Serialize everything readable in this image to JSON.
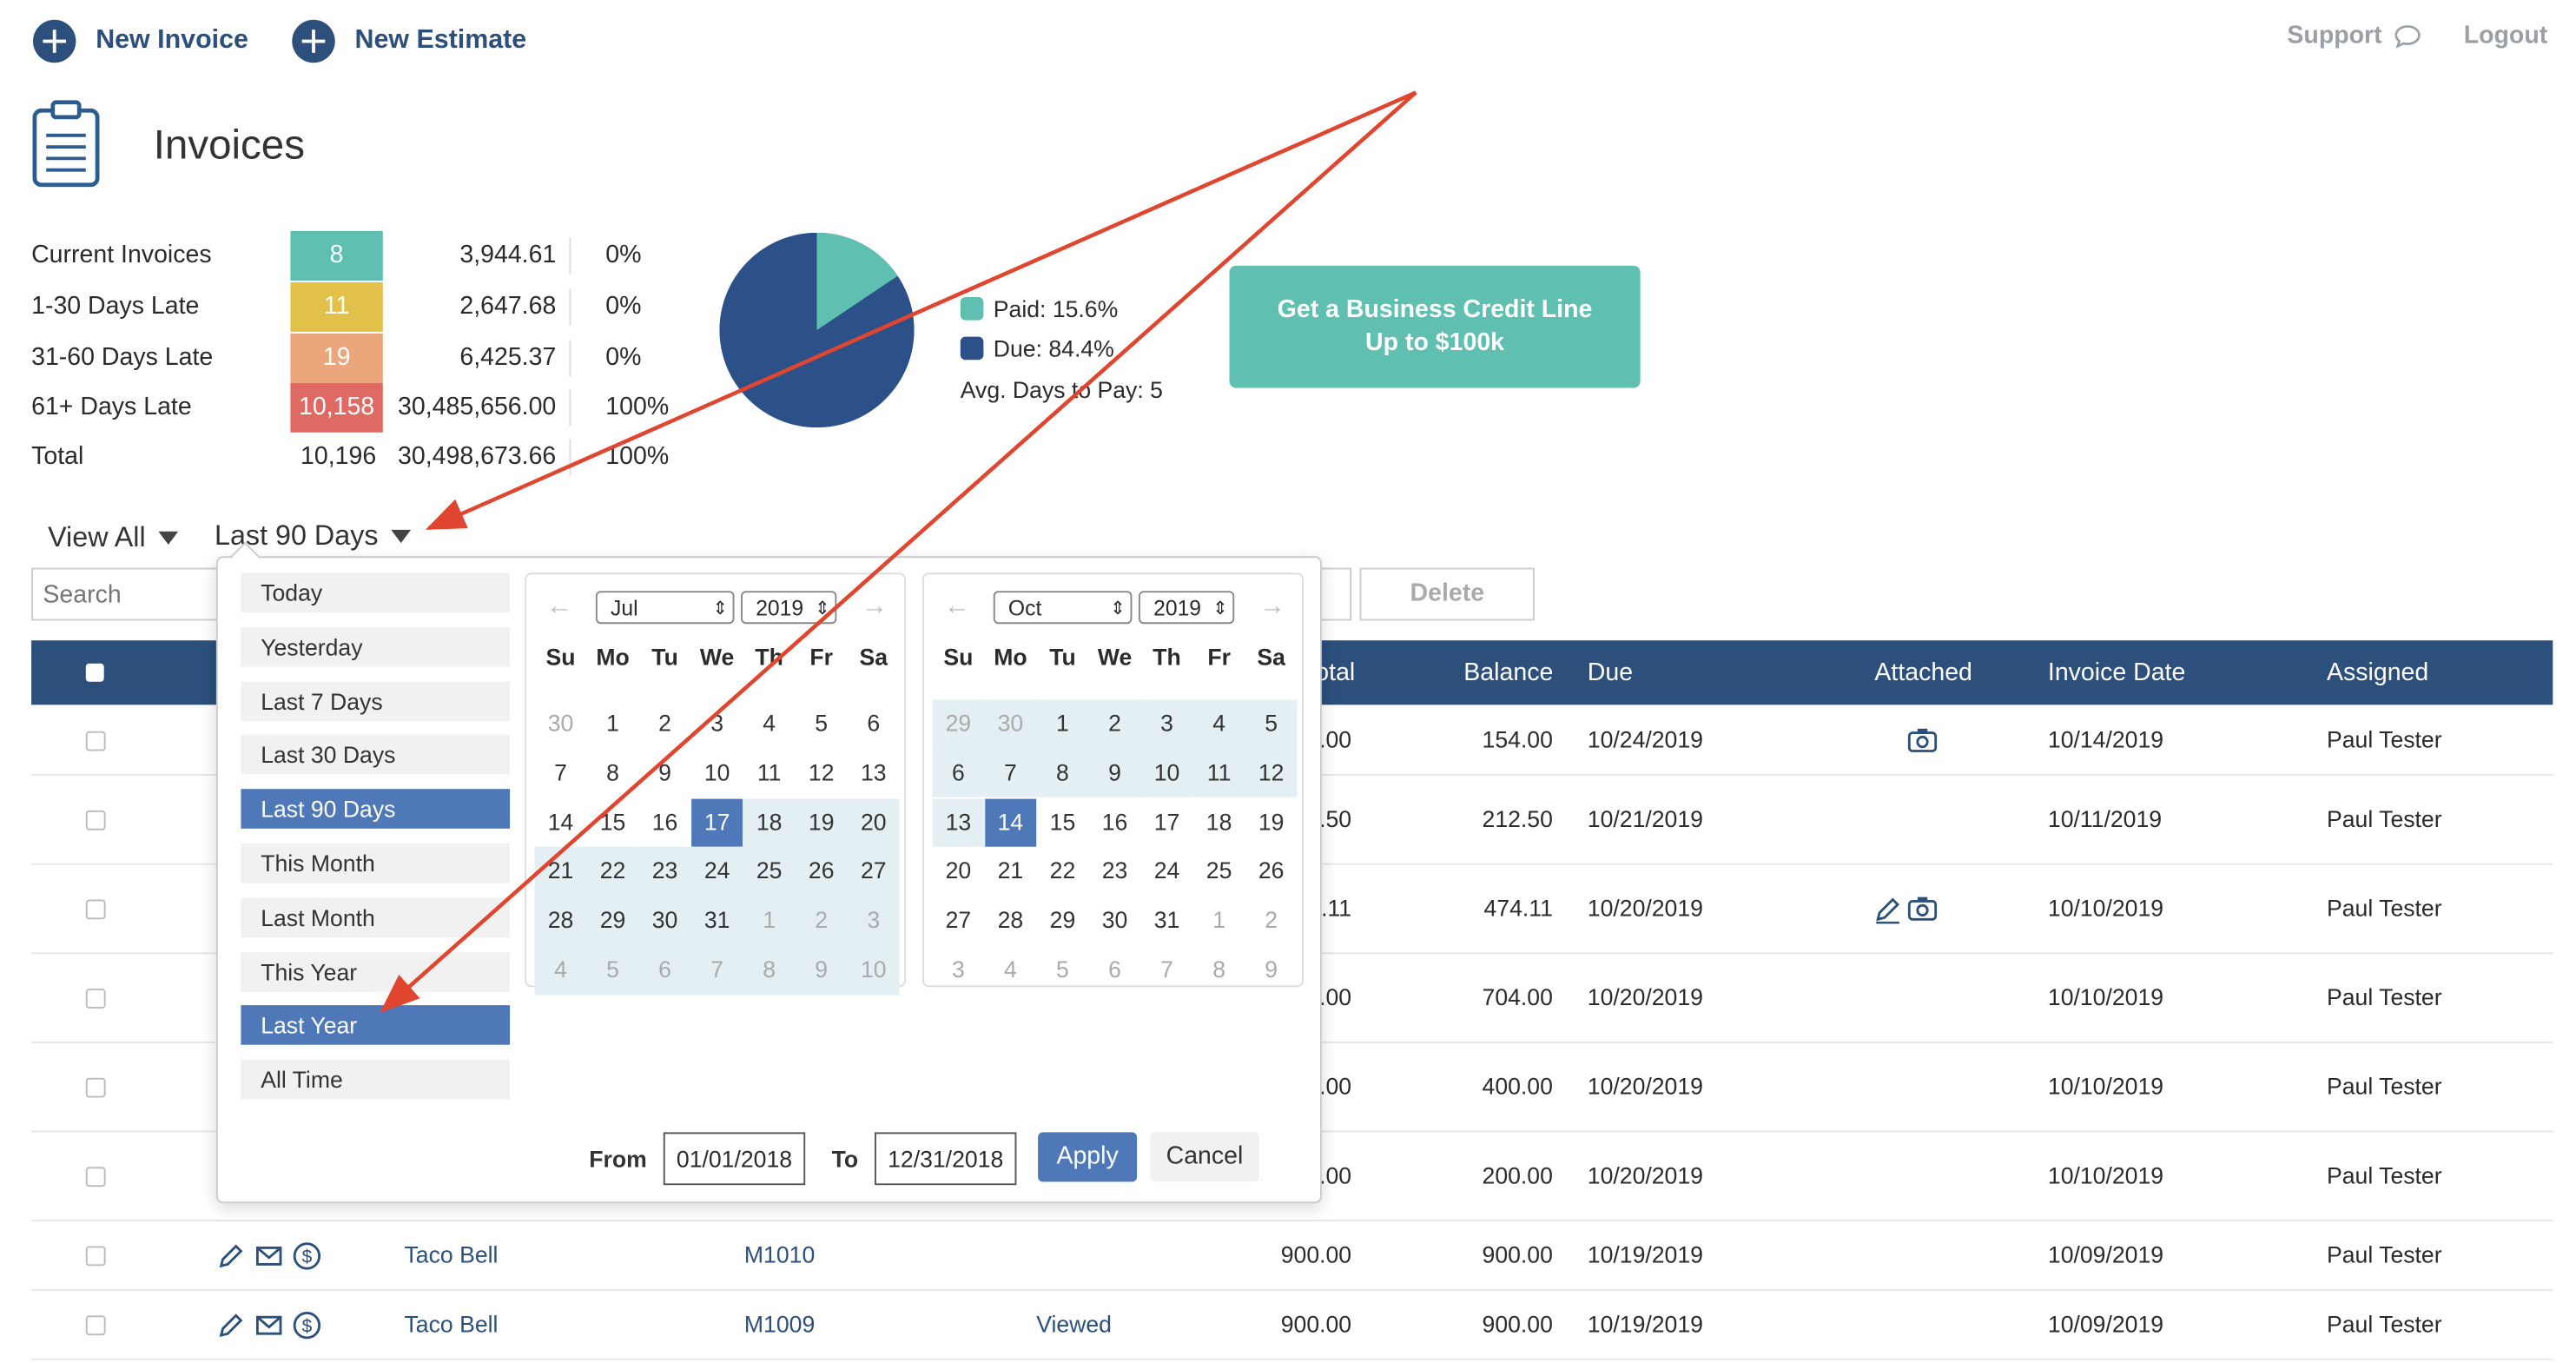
{
  "header": {
    "new_invoice": "New Invoice",
    "new_estimate": "New Estimate",
    "support": "Support",
    "logout": "Logout"
  },
  "page_title": "Invoices",
  "summary": [
    {
      "label": "Current Invoices",
      "count": "8",
      "amount": "3,944.61",
      "pct": "0%",
      "color": "#5fbfb0"
    },
    {
      "label": "1-30 Days Late",
      "count": "11",
      "amount": "2,647.68",
      "pct": "0%",
      "color": "#e2c14a"
    },
    {
      "label": "31-60 Days Late",
      "count": "19",
      "amount": "6,425.37",
      "pct": "0%",
      "color": "#eba67c"
    },
    {
      "label": "61+ Days Late",
      "count": "10,158",
      "amount": "30,485,656.00",
      "pct": "100%",
      "color": "#de6a63"
    },
    {
      "label": "Total",
      "count": "10,196",
      "amount": "30,498,673.66",
      "pct": "100%",
      "color": ""
    }
  ],
  "pie": {
    "paid_label": "Paid: 15.6%",
    "due_label": "Due: 84.4%",
    "avg_days": "Avg. Days to Pay: 5",
    "paid_fraction": 0.156,
    "paid_color": "#5fbfb0",
    "due_color": "#2c5188"
  },
  "promo": {
    "line1": "Get a Business Credit Line",
    "line2": "Up to $100k"
  },
  "filters": {
    "view_all": "View All",
    "period": "Last 90 Days"
  },
  "search": {
    "placeholder": "Search"
  },
  "delete_label": "Delete",
  "table": {
    "columns": {
      "total": "otal",
      "balance": "Balance",
      "due": "Due",
      "attached": "Attached",
      "invoice_date": "Invoice Date",
      "assigned": "Assigned"
    },
    "rows": [
      {
        "customer": "",
        "number": "",
        "status": "",
        "total": ".00",
        "balance": "154.00",
        "due": "10/24/2019",
        "date": "10/14/2019",
        "assigned": "Paul Tester"
      },
      {
        "customer": "",
        "number": "",
        "status": "",
        "total": ".50",
        "balance": "212.50",
        "due": "10/21/2019",
        "date": "10/11/2019",
        "assigned": "Paul Tester"
      },
      {
        "customer": "",
        "number": "",
        "status": "",
        "total": ".11",
        "balance": "474.11",
        "due": "10/20/2019",
        "date": "10/10/2019",
        "assigned": "Paul Tester"
      },
      {
        "customer": "",
        "number": "",
        "status": "",
        "total": ".00",
        "balance": "704.00",
        "due": "10/20/2019",
        "date": "10/10/2019",
        "assigned": "Paul Tester"
      },
      {
        "customer": "",
        "number": "",
        "status": "",
        "total": ".00",
        "balance": "400.00",
        "due": "10/20/2019",
        "date": "10/10/2019",
        "assigned": "Paul Tester"
      },
      {
        "customer": "",
        "number": "",
        "status": "",
        "total": ".00",
        "balance": "200.00",
        "due": "10/20/2019",
        "date": "10/10/2019",
        "assigned": "Paul Tester"
      },
      {
        "customer": "Taco Bell",
        "number": "M1010",
        "status": "",
        "total": "900.00",
        "balance": "900.00",
        "due": "10/19/2019",
        "date": "10/09/2019",
        "assigned": "Paul Tester"
      },
      {
        "customer": "Taco Bell",
        "number": "M1009",
        "status": "Viewed",
        "total": "900.00",
        "balance": "900.00",
        "due": "10/19/2019",
        "date": "10/09/2019",
        "assigned": "Paul Tester"
      }
    ]
  },
  "date_picker": {
    "ranges": [
      "Today",
      "Yesterday",
      "Last 7 Days",
      "Last 30 Days",
      "Last 90 Days",
      "This Month",
      "Last Month",
      "This Year",
      "Last Year",
      "All Time"
    ],
    "selected_ranges": [
      "Last 90 Days",
      "Last Year"
    ],
    "weekdays": [
      "Su",
      "Mo",
      "Tu",
      "We",
      "Th",
      "Fr",
      "Sa"
    ],
    "left": {
      "month": "Jul",
      "year": "2019",
      "days": [
        "30",
        "1",
        "2",
        "3",
        "4",
        "5",
        "6",
        "7",
        "8",
        "9",
        "10",
        "11",
        "12",
        "13",
        "14",
        "15",
        "16",
        "17",
        "18",
        "19",
        "20",
        "21",
        "22",
        "23",
        "24",
        "25",
        "26",
        "27",
        "28",
        "29",
        "30",
        "31",
        "1",
        "2",
        "3",
        "4",
        "5",
        "6",
        "7",
        "8",
        "9",
        "10"
      ],
      "dim": [
        0,
        32,
        33,
        34,
        35,
        36,
        37,
        38,
        39,
        40,
        41
      ],
      "active": [
        17
      ],
      "range_start": 17
    },
    "right": {
      "month": "Oct",
      "year": "2019",
      "days": [
        "29",
        "30",
        "1",
        "2",
        "3",
        "4",
        "5",
        "6",
        "7",
        "8",
        "9",
        "10",
        "11",
        "12",
        "13",
        "14",
        "15",
        "16",
        "17",
        "18",
        "19",
        "20",
        "21",
        "22",
        "23",
        "24",
        "25",
        "26",
        "27",
        "28",
        "29",
        "30",
        "31",
        "1",
        "2",
        "3",
        "4",
        "5",
        "6",
        "7",
        "8",
        "9"
      ],
      "dim": [
        0,
        1,
        33,
        34,
        35,
        36,
        37,
        38,
        39,
        40,
        41
      ],
      "active": [
        15
      ],
      "range_end": 15
    },
    "from_label": "From",
    "from_value": "01/01/2018",
    "to_label": "To",
    "to_value": "12/31/2018",
    "apply": "Apply",
    "cancel": "Cancel"
  }
}
